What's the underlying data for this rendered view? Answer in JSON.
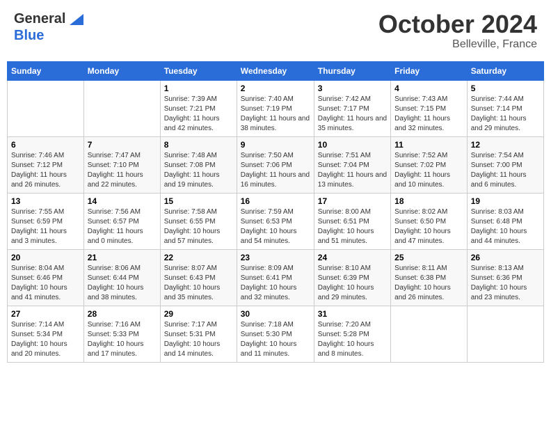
{
  "header": {
    "logo_line1": "General",
    "logo_line2": "Blue",
    "month": "October 2024",
    "location": "Belleville, France"
  },
  "days_of_week": [
    "Sunday",
    "Monday",
    "Tuesday",
    "Wednesday",
    "Thursday",
    "Friday",
    "Saturday"
  ],
  "weeks": [
    [
      {
        "day": "",
        "info": ""
      },
      {
        "day": "",
        "info": ""
      },
      {
        "day": "1",
        "info": "Sunrise: 7:39 AM\nSunset: 7:21 PM\nDaylight: 11 hours and 42 minutes."
      },
      {
        "day": "2",
        "info": "Sunrise: 7:40 AM\nSunset: 7:19 PM\nDaylight: 11 hours and 38 minutes."
      },
      {
        "day": "3",
        "info": "Sunrise: 7:42 AM\nSunset: 7:17 PM\nDaylight: 11 hours and 35 minutes."
      },
      {
        "day": "4",
        "info": "Sunrise: 7:43 AM\nSunset: 7:15 PM\nDaylight: 11 hours and 32 minutes."
      },
      {
        "day": "5",
        "info": "Sunrise: 7:44 AM\nSunset: 7:14 PM\nDaylight: 11 hours and 29 minutes."
      }
    ],
    [
      {
        "day": "6",
        "info": "Sunrise: 7:46 AM\nSunset: 7:12 PM\nDaylight: 11 hours and 26 minutes."
      },
      {
        "day": "7",
        "info": "Sunrise: 7:47 AM\nSunset: 7:10 PM\nDaylight: 11 hours and 22 minutes."
      },
      {
        "day": "8",
        "info": "Sunrise: 7:48 AM\nSunset: 7:08 PM\nDaylight: 11 hours and 19 minutes."
      },
      {
        "day": "9",
        "info": "Sunrise: 7:50 AM\nSunset: 7:06 PM\nDaylight: 11 hours and 16 minutes."
      },
      {
        "day": "10",
        "info": "Sunrise: 7:51 AM\nSunset: 7:04 PM\nDaylight: 11 hours and 13 minutes."
      },
      {
        "day": "11",
        "info": "Sunrise: 7:52 AM\nSunset: 7:02 PM\nDaylight: 11 hours and 10 minutes."
      },
      {
        "day": "12",
        "info": "Sunrise: 7:54 AM\nSunset: 7:00 PM\nDaylight: 11 hours and 6 minutes."
      }
    ],
    [
      {
        "day": "13",
        "info": "Sunrise: 7:55 AM\nSunset: 6:59 PM\nDaylight: 11 hours and 3 minutes."
      },
      {
        "day": "14",
        "info": "Sunrise: 7:56 AM\nSunset: 6:57 PM\nDaylight: 11 hours and 0 minutes."
      },
      {
        "day": "15",
        "info": "Sunrise: 7:58 AM\nSunset: 6:55 PM\nDaylight: 10 hours and 57 minutes."
      },
      {
        "day": "16",
        "info": "Sunrise: 7:59 AM\nSunset: 6:53 PM\nDaylight: 10 hours and 54 minutes."
      },
      {
        "day": "17",
        "info": "Sunrise: 8:00 AM\nSunset: 6:51 PM\nDaylight: 10 hours and 51 minutes."
      },
      {
        "day": "18",
        "info": "Sunrise: 8:02 AM\nSunset: 6:50 PM\nDaylight: 10 hours and 47 minutes."
      },
      {
        "day": "19",
        "info": "Sunrise: 8:03 AM\nSunset: 6:48 PM\nDaylight: 10 hours and 44 minutes."
      }
    ],
    [
      {
        "day": "20",
        "info": "Sunrise: 8:04 AM\nSunset: 6:46 PM\nDaylight: 10 hours and 41 minutes."
      },
      {
        "day": "21",
        "info": "Sunrise: 8:06 AM\nSunset: 6:44 PM\nDaylight: 10 hours and 38 minutes."
      },
      {
        "day": "22",
        "info": "Sunrise: 8:07 AM\nSunset: 6:43 PM\nDaylight: 10 hours and 35 minutes."
      },
      {
        "day": "23",
        "info": "Sunrise: 8:09 AM\nSunset: 6:41 PM\nDaylight: 10 hours and 32 minutes."
      },
      {
        "day": "24",
        "info": "Sunrise: 8:10 AM\nSunset: 6:39 PM\nDaylight: 10 hours and 29 minutes."
      },
      {
        "day": "25",
        "info": "Sunrise: 8:11 AM\nSunset: 6:38 PM\nDaylight: 10 hours and 26 minutes."
      },
      {
        "day": "26",
        "info": "Sunrise: 8:13 AM\nSunset: 6:36 PM\nDaylight: 10 hours and 23 minutes."
      }
    ],
    [
      {
        "day": "27",
        "info": "Sunrise: 7:14 AM\nSunset: 5:34 PM\nDaylight: 10 hours and 20 minutes."
      },
      {
        "day": "28",
        "info": "Sunrise: 7:16 AM\nSunset: 5:33 PM\nDaylight: 10 hours and 17 minutes."
      },
      {
        "day": "29",
        "info": "Sunrise: 7:17 AM\nSunset: 5:31 PM\nDaylight: 10 hours and 14 minutes."
      },
      {
        "day": "30",
        "info": "Sunrise: 7:18 AM\nSunset: 5:30 PM\nDaylight: 10 hours and 11 minutes."
      },
      {
        "day": "31",
        "info": "Sunrise: 7:20 AM\nSunset: 5:28 PM\nDaylight: 10 hours and 8 minutes."
      },
      {
        "day": "",
        "info": ""
      },
      {
        "day": "",
        "info": ""
      }
    ]
  ]
}
